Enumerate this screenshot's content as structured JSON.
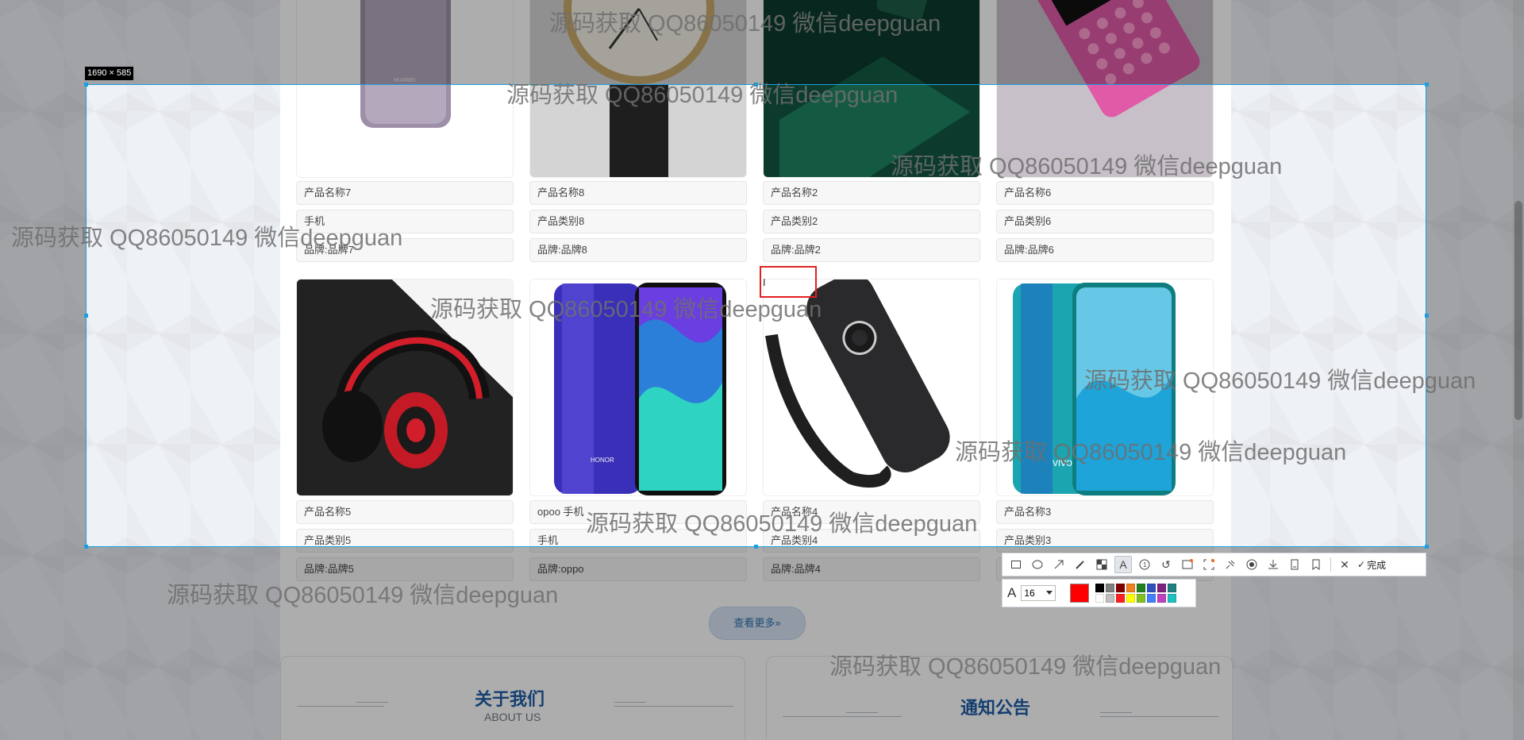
{
  "products_row1": [
    {
      "name": "产品名称7",
      "category": "手机",
      "brand": "品牌:品牌7",
      "image": "huawei-phone-back"
    },
    {
      "name": "产品名称8",
      "category": "产品类别8",
      "brand": "品牌:品牌8",
      "image": "iwc-watch"
    },
    {
      "name": "产品名称2",
      "category": "产品类别2",
      "brand": "品牌:品牌2",
      "image": "green-power-bank"
    },
    {
      "name": "产品名称6",
      "category": "产品类别6",
      "brand": "品牌:品牌6",
      "image": "pink-feature-phone"
    }
  ],
  "products_row2": [
    {
      "name": "产品名称5",
      "category": "产品类别5",
      "brand": "品牌:品牌5",
      "image": "red-headphones"
    },
    {
      "name": "opoo 手机",
      "category": "手机",
      "brand": "品牌:oppo",
      "image": "honor-phone"
    },
    {
      "name": "产品名称4",
      "category": "产品类别4",
      "brand": "品牌:品牌4",
      "image": "tv-remote"
    },
    {
      "name": "产品名称3",
      "category": "产品类别3",
      "brand": "",
      "image": "vivo-phone"
    }
  ],
  "more_button": "查看更多»",
  "about": {
    "title": "关于我们",
    "subtitle": "ABOUT US"
  },
  "notice": {
    "title": "通知公告"
  },
  "screenshot_tool": {
    "size_label": "1690 × 585",
    "done_label": "完成",
    "font_size": "16",
    "current_color": "#ff0000",
    "palette": [
      "#000000",
      "#808080",
      "#800000",
      "#f08020",
      "#208020",
      "#3050c0",
      "#802080",
      "#208080",
      "#ffffff",
      "#c0c0c0",
      "#ff2020",
      "#ffff00",
      "#80c020",
      "#4080ff",
      "#c040c0",
      "#20c0c0"
    ],
    "tools": [
      "rectangle-icon",
      "ellipse-icon",
      "arrow-icon",
      "pen-icon",
      "mosaic-icon",
      "text-icon",
      "number-icon",
      "undo-icon",
      "ocr-icon",
      "scan-icon",
      "pin-icon",
      "record-icon",
      "save-icon",
      "long-screenshot-icon",
      "bookmark-icon",
      "close-icon"
    ]
  },
  "watermark_text": "源码获取 QQ86050149 微信deepguan"
}
